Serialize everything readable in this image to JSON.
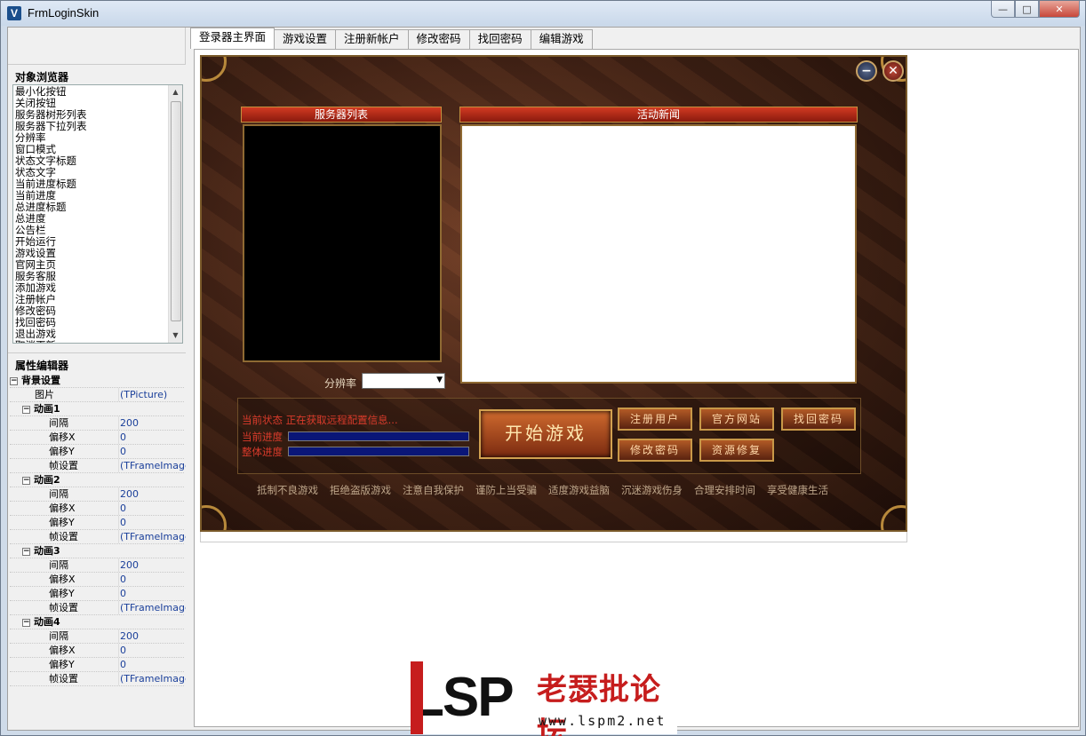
{
  "window": {
    "title": "FrmLoginSkin",
    "app_icon": "V"
  },
  "object_browser": {
    "title": "对象浏览器",
    "items": [
      "最小化按钮",
      "关闭按钮",
      "服务器树形列表",
      "服务器下拉列表",
      "分辨率",
      "窗口模式",
      "状态文字标题",
      "状态文字",
      "当前进度标题",
      "当前进度",
      "总进度标题",
      "总进度",
      "公告栏",
      "开始运行",
      "游戏设置",
      "官网主页",
      "服务客服",
      "添加游戏",
      "注册帐户",
      "修改密码",
      "找回密码",
      "退出游戏",
      "取消更新"
    ]
  },
  "property_editor": {
    "title": "属性编辑器",
    "rows": [
      {
        "key": "背景设置",
        "value": "",
        "level": 0,
        "group": true
      },
      {
        "key": "图片",
        "value": "(TPicture)",
        "level": 1,
        "group": false
      },
      {
        "key": "动画1",
        "value": "",
        "level": 1,
        "group": true
      },
      {
        "key": "间隔",
        "value": "200",
        "level": 2,
        "group": false
      },
      {
        "key": "偏移X",
        "value": "0",
        "level": 2,
        "group": false
      },
      {
        "key": "偏移Y",
        "value": "0",
        "level": 2,
        "group": false
      },
      {
        "key": "帧设置",
        "value": "(TFrameImages",
        "level": 2,
        "group": false
      },
      {
        "key": "动画2",
        "value": "",
        "level": 1,
        "group": true
      },
      {
        "key": "间隔",
        "value": "200",
        "level": 2,
        "group": false
      },
      {
        "key": "偏移X",
        "value": "0",
        "level": 2,
        "group": false
      },
      {
        "key": "偏移Y",
        "value": "0",
        "level": 2,
        "group": false
      },
      {
        "key": "帧设置",
        "value": "(TFrameImages",
        "level": 2,
        "group": false
      },
      {
        "key": "动画3",
        "value": "",
        "level": 1,
        "group": true
      },
      {
        "key": "间隔",
        "value": "200",
        "level": 2,
        "group": false
      },
      {
        "key": "偏移X",
        "value": "0",
        "level": 2,
        "group": false
      },
      {
        "key": "偏移Y",
        "value": "0",
        "level": 2,
        "group": false
      },
      {
        "key": "帧设置",
        "value": "(TFrameImages",
        "level": 2,
        "group": false
      },
      {
        "key": "动画4",
        "value": "",
        "level": 1,
        "group": true
      },
      {
        "key": "间隔",
        "value": "200",
        "level": 2,
        "group": false
      },
      {
        "key": "偏移X",
        "value": "0",
        "level": 2,
        "group": false
      },
      {
        "key": "偏移Y",
        "value": "0",
        "level": 2,
        "group": false
      },
      {
        "key": "帧设置",
        "value": "(TFrameImages",
        "level": 2,
        "group": false
      }
    ]
  },
  "tabs": [
    "登录器主界面",
    "游戏设置",
    "注册新帐户",
    "修改密码",
    "找回密码",
    "编辑游戏"
  ],
  "skin": {
    "server_list_title": "服务器列表",
    "news_title": "活动新闻",
    "resolution_label": "分辨率",
    "status_label": "当前状态",
    "status_text": "正在获取远程配置信息...",
    "current_progress_label": "当前进度",
    "total_progress_label": "整体进度",
    "start_button": "开始游戏",
    "buttons": [
      "注册用户",
      "官方网站",
      "找回密码",
      "修改密码",
      "资源修复"
    ],
    "slogans": [
      "抵制不良游戏",
      "拒绝盗版游戏",
      "注意自我保护",
      "谨防上当受骗",
      "适度游戏益脑",
      "沉迷游戏伤身",
      "合理安排时间",
      "享受健康生活"
    ]
  },
  "watermark": {
    "logo": "LSP",
    "name": "老瑟批论坛",
    "url": "www.lspm2.net"
  },
  "colors": {
    "accent": "#c61d1d",
    "progress": "#0a1677"
  }
}
